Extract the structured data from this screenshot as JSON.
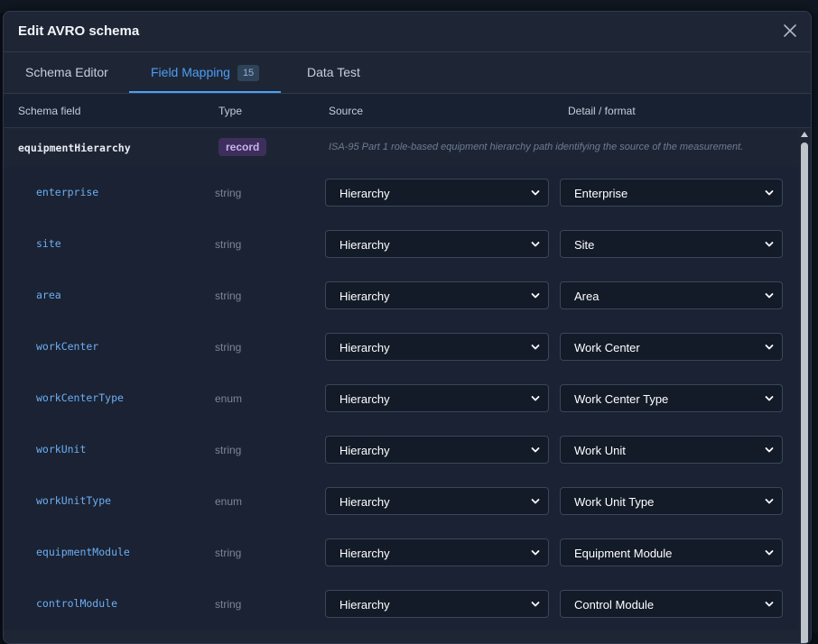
{
  "dialog": {
    "title": "Edit AVRO schema"
  },
  "tabs": [
    {
      "label": "Schema Editor"
    },
    {
      "label": "Field Mapping",
      "count": "15",
      "active": true
    },
    {
      "label": "Data Test"
    }
  ],
  "columns": {
    "field": "Schema field",
    "type": "Type",
    "source": "Source",
    "detail": "Detail / format"
  },
  "group": {
    "name": "equipmentHierarchy",
    "type": "record",
    "description": "ISA-95 Part 1 role-based equipment hierarchy path identifying the source of the measurement."
  },
  "rows": [
    {
      "field": "enterprise",
      "type": "string",
      "source": "Hierarchy",
      "detail": "Enterprise"
    },
    {
      "field": "site",
      "type": "string",
      "source": "Hierarchy",
      "detail": "Site"
    },
    {
      "field": "area",
      "type": "string",
      "source": "Hierarchy",
      "detail": "Area"
    },
    {
      "field": "workCenter",
      "type": "string",
      "source": "Hierarchy",
      "detail": "Work Center"
    },
    {
      "field": "workCenterType",
      "type": "enum",
      "source": "Hierarchy",
      "detail": "Work Center Type"
    },
    {
      "field": "workUnit",
      "type": "string",
      "source": "Hierarchy",
      "detail": "Work Unit"
    },
    {
      "field": "workUnitType",
      "type": "enum",
      "source": "Hierarchy",
      "detail": "Work Unit Type"
    },
    {
      "field": "equipmentModule",
      "type": "string",
      "source": "Hierarchy",
      "detail": "Equipment Module"
    },
    {
      "field": "controlModule",
      "type": "string",
      "source": "Hierarchy",
      "detail": "Control Module"
    }
  ],
  "colors": {
    "accent": "#4d9ef5",
    "record_badge": "#3e2e5c",
    "field_name": "#6eaef2"
  }
}
